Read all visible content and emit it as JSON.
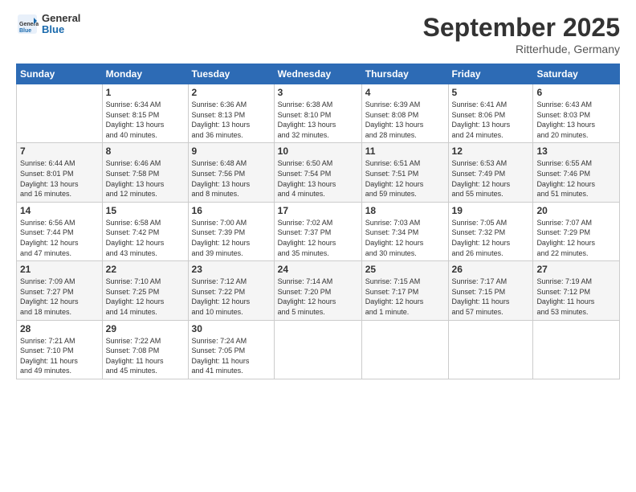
{
  "header": {
    "logo_general": "General",
    "logo_blue": "Blue",
    "month_title": "September 2025",
    "location": "Ritterhude, Germany"
  },
  "days_of_week": [
    "Sunday",
    "Monday",
    "Tuesday",
    "Wednesday",
    "Thursday",
    "Friday",
    "Saturday"
  ],
  "weeks": [
    [
      {
        "day": "",
        "info": ""
      },
      {
        "day": "1",
        "info": "Sunrise: 6:34 AM\nSunset: 8:15 PM\nDaylight: 13 hours\nand 40 minutes."
      },
      {
        "day": "2",
        "info": "Sunrise: 6:36 AM\nSunset: 8:13 PM\nDaylight: 13 hours\nand 36 minutes."
      },
      {
        "day": "3",
        "info": "Sunrise: 6:38 AM\nSunset: 8:10 PM\nDaylight: 13 hours\nand 32 minutes."
      },
      {
        "day": "4",
        "info": "Sunrise: 6:39 AM\nSunset: 8:08 PM\nDaylight: 13 hours\nand 28 minutes."
      },
      {
        "day": "5",
        "info": "Sunrise: 6:41 AM\nSunset: 8:06 PM\nDaylight: 13 hours\nand 24 minutes."
      },
      {
        "day": "6",
        "info": "Sunrise: 6:43 AM\nSunset: 8:03 PM\nDaylight: 13 hours\nand 20 minutes."
      }
    ],
    [
      {
        "day": "7",
        "info": "Sunrise: 6:44 AM\nSunset: 8:01 PM\nDaylight: 13 hours\nand 16 minutes."
      },
      {
        "day": "8",
        "info": "Sunrise: 6:46 AM\nSunset: 7:58 PM\nDaylight: 13 hours\nand 12 minutes."
      },
      {
        "day": "9",
        "info": "Sunrise: 6:48 AM\nSunset: 7:56 PM\nDaylight: 13 hours\nand 8 minutes."
      },
      {
        "day": "10",
        "info": "Sunrise: 6:50 AM\nSunset: 7:54 PM\nDaylight: 13 hours\nand 4 minutes."
      },
      {
        "day": "11",
        "info": "Sunrise: 6:51 AM\nSunset: 7:51 PM\nDaylight: 12 hours\nand 59 minutes."
      },
      {
        "day": "12",
        "info": "Sunrise: 6:53 AM\nSunset: 7:49 PM\nDaylight: 12 hours\nand 55 minutes."
      },
      {
        "day": "13",
        "info": "Sunrise: 6:55 AM\nSunset: 7:46 PM\nDaylight: 12 hours\nand 51 minutes."
      }
    ],
    [
      {
        "day": "14",
        "info": "Sunrise: 6:56 AM\nSunset: 7:44 PM\nDaylight: 12 hours\nand 47 minutes."
      },
      {
        "day": "15",
        "info": "Sunrise: 6:58 AM\nSunset: 7:42 PM\nDaylight: 12 hours\nand 43 minutes."
      },
      {
        "day": "16",
        "info": "Sunrise: 7:00 AM\nSunset: 7:39 PM\nDaylight: 12 hours\nand 39 minutes."
      },
      {
        "day": "17",
        "info": "Sunrise: 7:02 AM\nSunset: 7:37 PM\nDaylight: 12 hours\nand 35 minutes."
      },
      {
        "day": "18",
        "info": "Sunrise: 7:03 AM\nSunset: 7:34 PM\nDaylight: 12 hours\nand 30 minutes."
      },
      {
        "day": "19",
        "info": "Sunrise: 7:05 AM\nSunset: 7:32 PM\nDaylight: 12 hours\nand 26 minutes."
      },
      {
        "day": "20",
        "info": "Sunrise: 7:07 AM\nSunset: 7:29 PM\nDaylight: 12 hours\nand 22 minutes."
      }
    ],
    [
      {
        "day": "21",
        "info": "Sunrise: 7:09 AM\nSunset: 7:27 PM\nDaylight: 12 hours\nand 18 minutes."
      },
      {
        "day": "22",
        "info": "Sunrise: 7:10 AM\nSunset: 7:25 PM\nDaylight: 12 hours\nand 14 minutes."
      },
      {
        "day": "23",
        "info": "Sunrise: 7:12 AM\nSunset: 7:22 PM\nDaylight: 12 hours\nand 10 minutes."
      },
      {
        "day": "24",
        "info": "Sunrise: 7:14 AM\nSunset: 7:20 PM\nDaylight: 12 hours\nand 5 minutes."
      },
      {
        "day": "25",
        "info": "Sunrise: 7:15 AM\nSunset: 7:17 PM\nDaylight: 12 hours\nand 1 minute."
      },
      {
        "day": "26",
        "info": "Sunrise: 7:17 AM\nSunset: 7:15 PM\nDaylight: 11 hours\nand 57 minutes."
      },
      {
        "day": "27",
        "info": "Sunrise: 7:19 AM\nSunset: 7:12 PM\nDaylight: 11 hours\nand 53 minutes."
      }
    ],
    [
      {
        "day": "28",
        "info": "Sunrise: 7:21 AM\nSunset: 7:10 PM\nDaylight: 11 hours\nand 49 minutes."
      },
      {
        "day": "29",
        "info": "Sunrise: 7:22 AM\nSunset: 7:08 PM\nDaylight: 11 hours\nand 45 minutes."
      },
      {
        "day": "30",
        "info": "Sunrise: 7:24 AM\nSunset: 7:05 PM\nDaylight: 11 hours\nand 41 minutes."
      },
      {
        "day": "",
        "info": ""
      },
      {
        "day": "",
        "info": ""
      },
      {
        "day": "",
        "info": ""
      },
      {
        "day": "",
        "info": ""
      }
    ]
  ]
}
